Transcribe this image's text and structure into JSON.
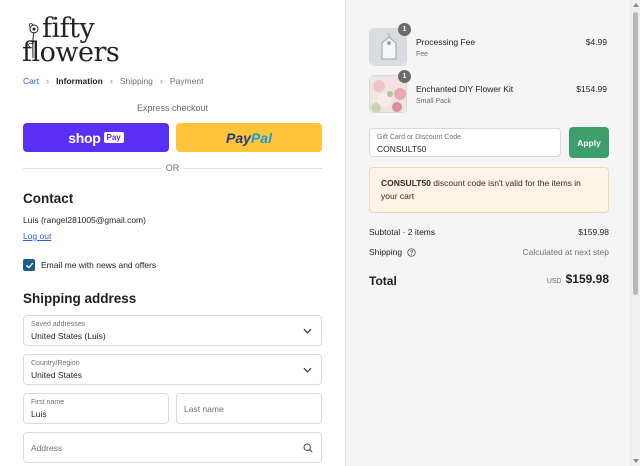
{
  "logo": {
    "line1": "fifty",
    "line2": "flowers"
  },
  "breadcrumb": {
    "items": [
      "Cart",
      "Information",
      "Shipping",
      "Payment"
    ],
    "separator": "›"
  },
  "express_checkout": {
    "label": "Express checkout",
    "shop_pay": {
      "word": "shop",
      "badge": "Pay"
    },
    "paypal": {
      "part1": "Pay",
      "part2": "Pal"
    },
    "or_label": "OR"
  },
  "contact": {
    "heading": "Contact",
    "email_line": "Luis (rangel281005@gmail.com)",
    "logout_label": "Log out",
    "newsletter_label": "Email me with news and offers",
    "newsletter_checked": true
  },
  "shipping_address": {
    "heading": "Shipping address",
    "saved_addresses": {
      "label": "Saved addresses",
      "value": "United States (Luis)"
    },
    "country": {
      "label": "Country/Region",
      "value": "United States"
    },
    "first_name": {
      "label": "First name",
      "value": "Luis"
    },
    "last_name": {
      "placeholder": "Last name"
    },
    "address": {
      "placeholder": "Address"
    }
  },
  "order_summary": {
    "items": [
      {
        "name": "Processing Fee",
        "variant": "Fee",
        "price": "$4.99",
        "quantity": "1",
        "thumb_icon": "price-tag-icon"
      },
      {
        "name": "Enchanted DIY Flower Kit",
        "variant": "Small Pack",
        "price": "$154.99",
        "quantity": "1",
        "thumb_icon": "flower-kit-photo"
      }
    ],
    "discount": {
      "label": "Gift Card or Discount Code",
      "value": "CONSULT50",
      "apply_label": "Apply"
    },
    "error": {
      "code": "CONSULT50",
      "message": " discount code isn't valid for the items in your cart"
    },
    "subtotal": {
      "label": "Subtotal · 2 items",
      "value": "$159.98"
    },
    "shipping": {
      "label": "Shipping",
      "value": "Calculated at next step"
    },
    "total": {
      "label": "Total",
      "currency": "USD",
      "value": "$159.98"
    }
  },
  "colors": {
    "shop_pay": "#5a31f4",
    "paypal": "#ffc439",
    "apply": "#3d9d6b",
    "link": "#2b5fd6",
    "checkbox": "#1b5e8c",
    "error_bg": "#fff4e5"
  }
}
